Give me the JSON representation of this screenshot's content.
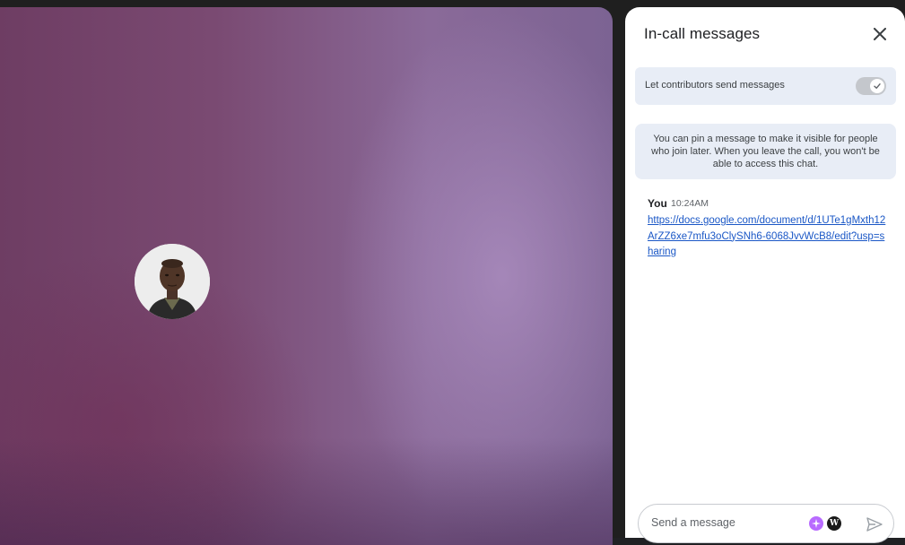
{
  "video": {
    "participant_avatar": "person-photo"
  },
  "panel": {
    "title": "In-call messages",
    "close_icon": "close-icon",
    "setting_label": "Let contributors send messages",
    "toggle_state": "on",
    "info_text": "You can pin a message to make it visible for people who join later. When you leave the call, you won't be able to access this chat.",
    "message": {
      "sender": "You",
      "time": "10:24AM",
      "link": "https://docs.google.com/document/d/1UTe1gMxth12ArZZ6xe7mfu3oClySNh6-6068JvvWcB8/edit?usp=sharing"
    },
    "compose": {
      "placeholder": "Send a message",
      "send_icon": "send-icon"
    }
  },
  "colors": {
    "link": "#1a57c6",
    "setting_bg": "#e8edf6",
    "ext_sparkle": "#b86bff"
  }
}
